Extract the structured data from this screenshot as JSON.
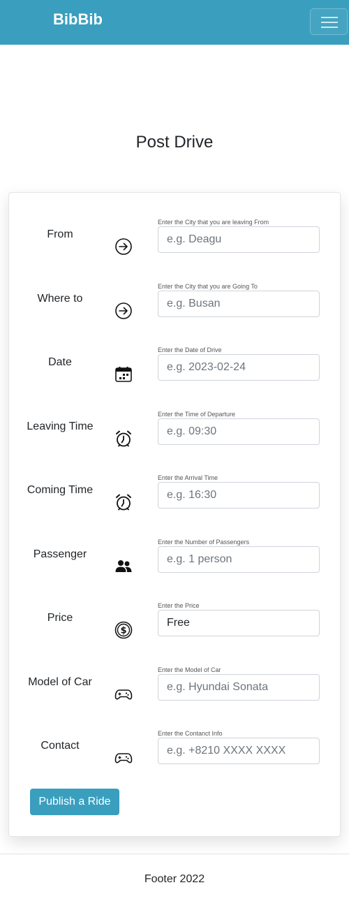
{
  "navbar": {
    "brand": "BibBib"
  },
  "page": {
    "title": "Post Drive"
  },
  "form": {
    "fields": [
      {
        "label": "From",
        "icon": "arrow-right-circle-icon",
        "hint": "Enter the City that you are leaving From",
        "placeholder": "e.g. Deagu",
        "value": ""
      },
      {
        "label": "Where to",
        "icon": "arrow-right-circle-icon",
        "hint": "Enter the City that you are Going To",
        "placeholder": "e.g. Busan",
        "value": ""
      },
      {
        "label": "Date",
        "icon": "calendar-icon",
        "hint": "Enter the Date of Drive",
        "placeholder": "e.g. 2023-02-24",
        "value": ""
      },
      {
        "label": "Leaving Time",
        "icon": "alarm-clock-icon",
        "hint": "Enter the Time of Departure",
        "placeholder": "e.g. 09:30",
        "value": ""
      },
      {
        "label": "Coming Time",
        "icon": "alarm-clock-icon",
        "hint": "Enter the Arrival Time",
        "placeholder": "e.g. 16:30",
        "value": ""
      },
      {
        "label": "Passenger",
        "icon": "people-icon",
        "hint": "Enter the Number of Passengers",
        "placeholder": "e.g. 1 person",
        "value": ""
      },
      {
        "label": "Price",
        "icon": "dollar-coin-icon",
        "hint": "Enter the Price",
        "placeholder": "",
        "value": "Free"
      },
      {
        "label": "Model of Car",
        "icon": "controller-icon",
        "hint": "Enter the Model of Car",
        "placeholder": "e.g. Hyundai Sonata",
        "value": ""
      },
      {
        "label": "Contact",
        "icon": "controller-icon",
        "hint": "Enter the Contanct Info",
        "placeholder": "e.g. +8210 XXXX XXXX",
        "value": ""
      }
    ],
    "submit_label": "Publish a Ride"
  },
  "footer": {
    "text": "Footer 2022"
  },
  "colors": {
    "accent": "#3a9fbf"
  }
}
